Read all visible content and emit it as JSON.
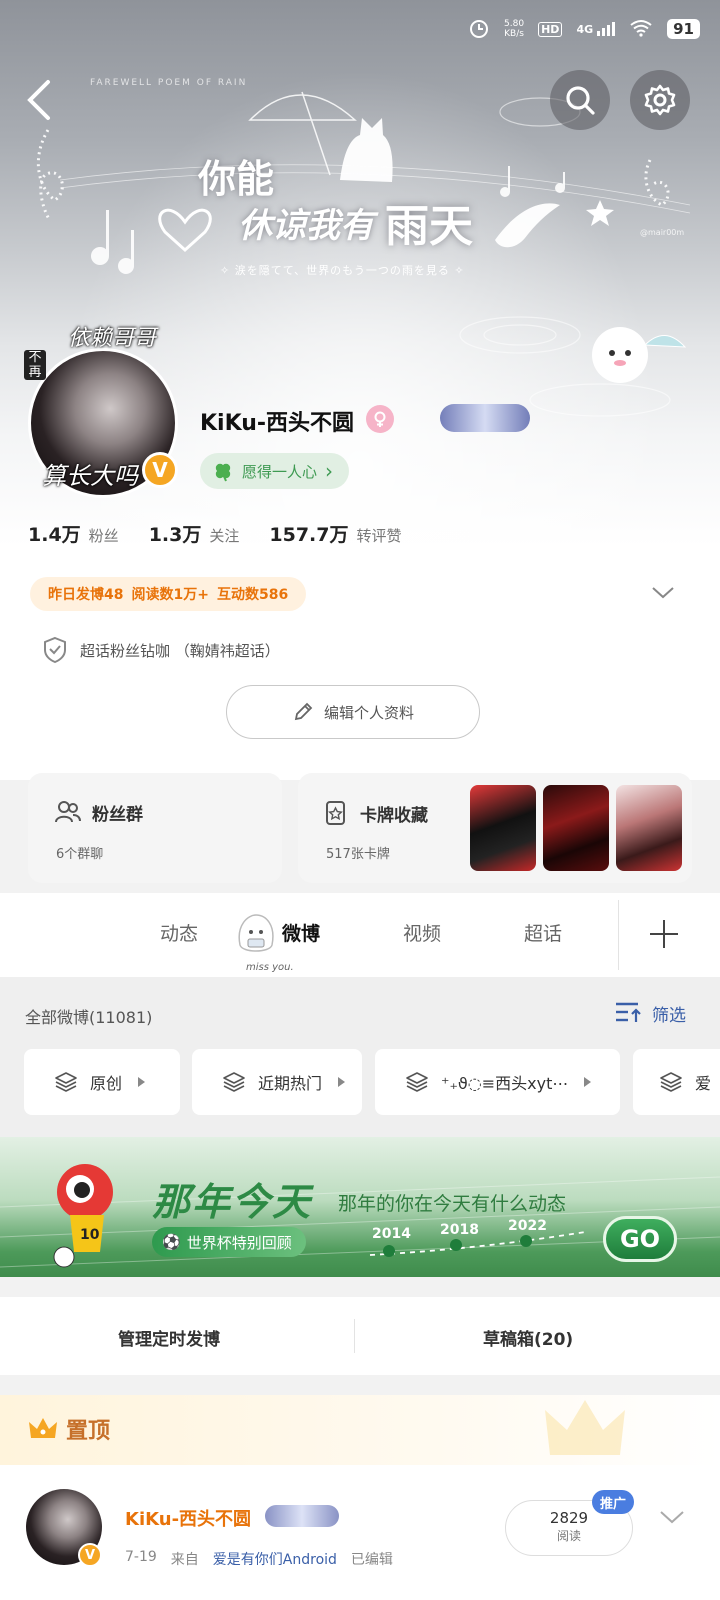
{
  "status_bar": {
    "net_speed": "5.80",
    "net_unit": "KB/s",
    "hd": "HD",
    "signal": "4G",
    "battery": "91"
  },
  "nav": {
    "back_icon": "chevron-left-icon",
    "search_icon": "search-icon",
    "settings_icon": "gear-icon"
  },
  "banner": {
    "watermark": "FAREWELL POEM OF RAIN",
    "line1": "你能",
    "line2": "休谅我有",
    "line3": "雨天",
    "subtitle": "✧ 涙を隠てて、世界のもう一つの雨を見る ✧",
    "handle": "@mair00m"
  },
  "profile": {
    "avatar_top_text": "依赖哥哥",
    "avatar_left_text": "不再",
    "avatar_bottom_text": "算长大吗",
    "verified_badge": "V",
    "username": "KiKu-西头不圆",
    "motto": "愿得一人心",
    "motto_chevron": "›"
  },
  "stats": [
    {
      "num": "1.4万",
      "label": "粉丝"
    },
    {
      "num": "1.3万",
      "label": "关注"
    },
    {
      "num": "157.7万",
      "label": "转评赞"
    }
  ],
  "activity": {
    "posts": "昨日发博48",
    "reads": "阅读数1万+",
    "interactions": "互动数586"
  },
  "chaohua": {
    "text": "超话粉丝钻咖 （鞠婧祎超话）"
  },
  "edit_profile": {
    "label": "编辑个人资料"
  },
  "cards": {
    "fans": {
      "title": "粉丝群",
      "sub": "6个群聊"
    },
    "collect": {
      "title": "卡牌收藏",
      "sub": "517张卡牌"
    }
  },
  "tabs": [
    {
      "label": "动态"
    },
    {
      "label": "微博"
    },
    {
      "label": "视频"
    },
    {
      "label": "超话"
    }
  ],
  "tab_deco_text": "miss you.",
  "feed": {
    "all_label": "全部微博(11081)",
    "filter_label": "筛选",
    "chips": [
      {
        "label": "原创"
      },
      {
        "label": "近期热门"
      },
      {
        "label": "⁺₊ϑ◌≡西头xyt⋯"
      },
      {
        "label": "爱"
      }
    ]
  },
  "promo": {
    "title": "那年今天",
    "subtitle": "那年的你在今天有什么动态",
    "pill": "世界杯特别回顾",
    "years": [
      "2014",
      "2018",
      "2022"
    ],
    "go": "GO"
  },
  "manage": {
    "scheduled": "管理定时发博",
    "drafts": "草稿箱(20)"
  },
  "pinned": {
    "title": "置顶",
    "post": {
      "name": "KiKu-西头不圆",
      "date": "7-19",
      "from": "来自",
      "source": "爱是有你们Android",
      "edited": "已编辑",
      "reads": "2829",
      "reads_label": "阅读",
      "promote": "推广"
    }
  },
  "colors": {
    "accent": "#e8730a",
    "link": "#3a5fa8",
    "green": "#3e9a52",
    "verified": "#f5a623"
  }
}
